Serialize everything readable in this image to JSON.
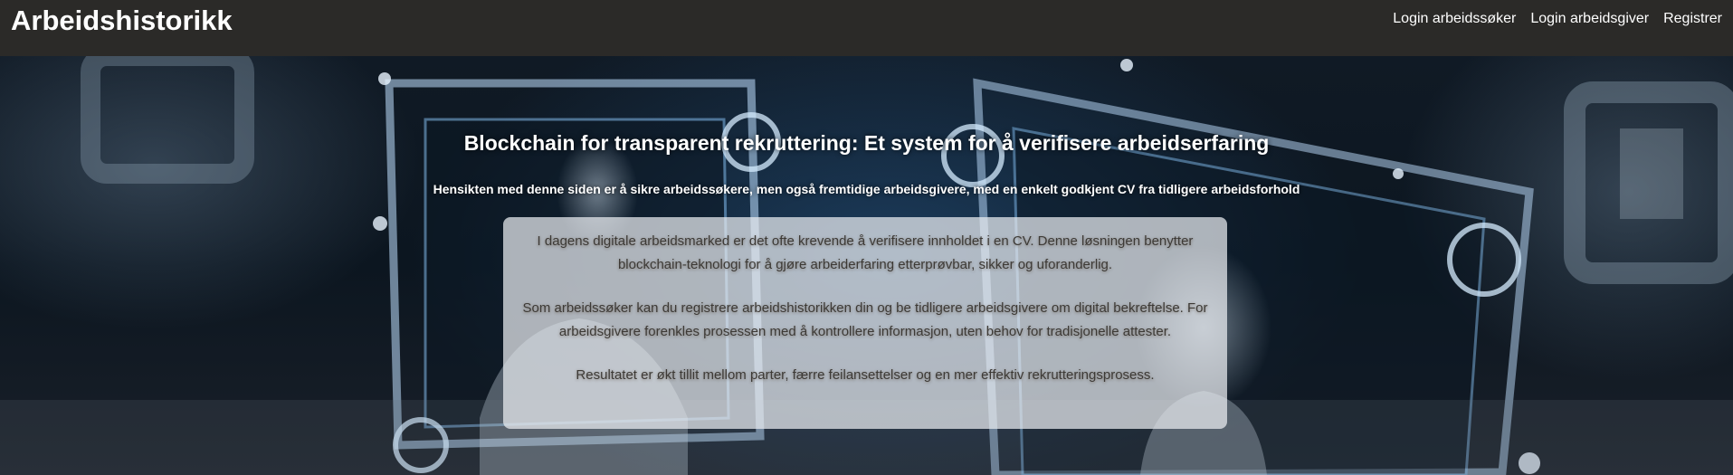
{
  "navbar": {
    "brand": "Arbeidshistorikk",
    "links": [
      {
        "label": "Login arbeidssøker"
      },
      {
        "label": "Login arbeidsgiver"
      },
      {
        "label": "Registrer"
      }
    ]
  },
  "hero": {
    "title": "Blockchain for transparent rekruttering: Et system for å verifisere arbeidserfaring",
    "subtitle": "Hensikten med denne siden er å sikre arbeidssøkere, men også fremtidige arbeidsgivere, med en enkelt godkjent CV fra tidligere arbeidsforhold",
    "paragraphs": [
      "I dagens digitale arbeidsmarked er det ofte krevende å verifisere innholdet i en CV. Denne løsningen benytter blockchain-teknologi for å gjøre arbeiderfaring etterprøvbar, sikker og uforanderlig.",
      "Som arbeidssøker kan du registrere arbeidshistorikken din og be tidligere arbeidsgivere om digital bekreftelse. For arbeidsgivere forenkles prosessen med å kontrollere informasjon, uten behov for tradisjonelle attester.",
      "Resultatet er økt tillit mellom parter, færre feilansettelser og en mer effektiv rekrutteringsprosess."
    ]
  },
  "colors": {
    "navbar_bg": "#2b2a28",
    "nav_text": "#ffffff",
    "box_text": "#3d3a36"
  }
}
